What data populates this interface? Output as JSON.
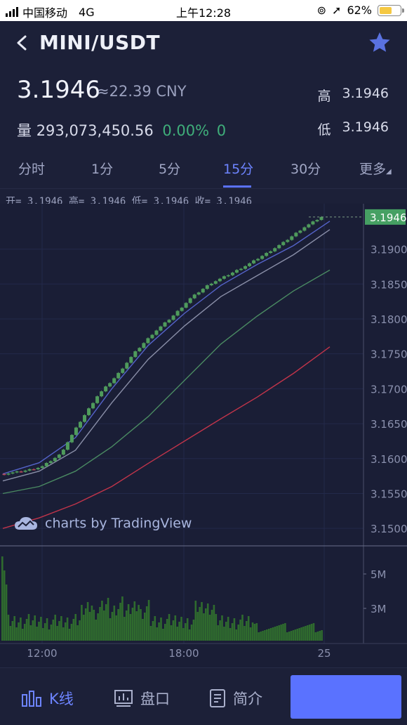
{
  "status_bar": {
    "carrier": "中国移动",
    "network": "4G",
    "time": "上午12:28",
    "battery": "62%",
    "battery_level": 0.62
  },
  "header": {
    "pair": "MINI/USDT"
  },
  "ticker": {
    "price": "3.1946",
    "cny": "≈22.39 CNY",
    "high_label": "高",
    "high_value": "3.1946",
    "low_label": "低",
    "low_value": "3.1946",
    "volume_label": "量",
    "volume_value": "293,073,450.56",
    "change_pct": "0.00%",
    "change_abs": "0"
  },
  "tabs": [
    {
      "label": "分时"
    },
    {
      "label": "1分"
    },
    {
      "label": "5分"
    },
    {
      "label": "15分",
      "active": true
    },
    {
      "label": "30分"
    },
    {
      "label": "更多"
    }
  ],
  "ohlc": "开= 3.1946 高= 3.1946 低= 3.1946 收= 3.1946",
  "watermark": "charts by TradingView",
  "chart_data": {
    "type": "candlestick",
    "last_price_label": "3.1946",
    "y_ticks": [
      "3.1900",
      "3.1850",
      "3.1800",
      "3.1750",
      "3.1700",
      "3.1650",
      "3.1600",
      "3.1550",
      "3.1500"
    ],
    "ylim": [
      3.1475,
      3.1965
    ],
    "volume_ticks": [
      "5M",
      "3M"
    ],
    "x_ticks": [
      "12:00",
      "18:00",
      "25"
    ],
    "ma_lines": [
      {
        "color": "#5463c9",
        "y": [
          3.1578,
          3.1594,
          3.163,
          3.17,
          3.1762,
          3.1808,
          3.1848,
          3.1878,
          3.1905,
          3.194
        ]
      },
      {
        "color": "#8a8fa8",
        "y": [
          3.1568,
          3.1582,
          3.1612,
          3.168,
          3.1742,
          3.179,
          3.1832,
          3.1862,
          3.1892,
          3.1928
        ]
      },
      {
        "color": "#4a8a62",
        "y": [
          3.155,
          3.156,
          3.1582,
          3.1617,
          3.166,
          3.1712,
          3.1764,
          3.1804,
          3.184,
          3.187
        ]
      },
      {
        "color": "#c0344a",
        "y": [
          3.15,
          3.1515,
          3.1535,
          3.156,
          3.1593,
          3.1625,
          3.1657,
          3.1688,
          3.1722,
          3.176
        ]
      }
    ],
    "price_path": [
      3.1578,
      3.1582,
      3.1588,
      3.1606,
      3.165,
      3.169,
      3.1718,
      3.1752,
      3.178,
      3.1803,
      3.183,
      3.185,
      3.1863,
      3.1877,
      3.1893,
      3.191,
      3.193,
      3.1946
    ]
  },
  "bottom_nav": [
    {
      "label": "K线",
      "icon": "kline-icon",
      "active": true
    },
    {
      "label": "盘口",
      "icon": "orderbook-icon"
    },
    {
      "label": "简介",
      "icon": "intro-icon"
    }
  ],
  "colors": {
    "background": "#1c2038",
    "accent": "#5a72ff",
    "up": "#4f9b5c",
    "price_label": "#46a063"
  }
}
